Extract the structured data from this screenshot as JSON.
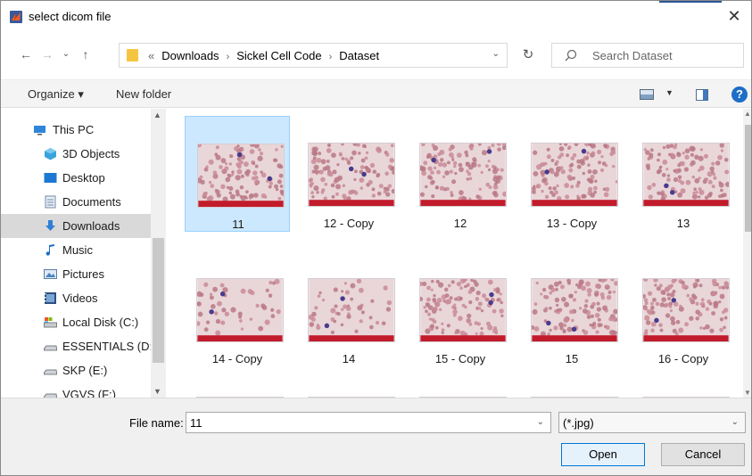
{
  "window": {
    "title": "select dicom file"
  },
  "address": {
    "overflow": "«",
    "breadcrumbs": [
      "Downloads",
      "Sickel Cell Code",
      "Dataset"
    ]
  },
  "search": {
    "placeholder": "Search Dataset"
  },
  "toolbar": {
    "organize_label": "Organize ▾",
    "new_folder_label": "New folder",
    "help": "?"
  },
  "sidebar": {
    "items": [
      {
        "label": "This PC",
        "icon": "pc-icon"
      },
      {
        "label": "3D Objects",
        "icon": "3d-objects-icon"
      },
      {
        "label": "Desktop",
        "icon": "desktop-icon"
      },
      {
        "label": "Documents",
        "icon": "documents-icon"
      },
      {
        "label": "Downloads",
        "icon": "downloads-icon",
        "selected": true
      },
      {
        "label": "Music",
        "icon": "music-icon"
      },
      {
        "label": "Pictures",
        "icon": "pictures-icon"
      },
      {
        "label": "Videos",
        "icon": "videos-icon"
      },
      {
        "label": "Local Disk (C:)",
        "icon": "local-disk-icon"
      },
      {
        "label": "ESSENTIALS (D:)",
        "icon": "drive-icon"
      },
      {
        "label": "SKP (E:)",
        "icon": "drive-icon"
      },
      {
        "label": "VGVS (F:)",
        "icon": "drive-icon"
      }
    ]
  },
  "files": [
    {
      "name": "11",
      "selected": true
    },
    {
      "name": "12 - Copy"
    },
    {
      "name": "12"
    },
    {
      "name": "13 - Copy"
    },
    {
      "name": "13"
    },
    {
      "name": "14 - Copy"
    },
    {
      "name": "14"
    },
    {
      "name": "15 - Copy"
    },
    {
      "name": "15"
    },
    {
      "name": "16 - Copy"
    },
    {
      "name": ""
    },
    {
      "name": ""
    },
    {
      "name": ""
    },
    {
      "name": ""
    },
    {
      "name": ""
    }
  ],
  "footer": {
    "file_name_label": "File name:",
    "file_name_value": "11",
    "filter_value": "(*.jpg)",
    "open_label": "Open",
    "cancel_label": "Cancel"
  },
  "colors": {
    "selection_bg": "#cce8ff",
    "selection_border": "#99d1ff",
    "accent": "#0078d7"
  }
}
